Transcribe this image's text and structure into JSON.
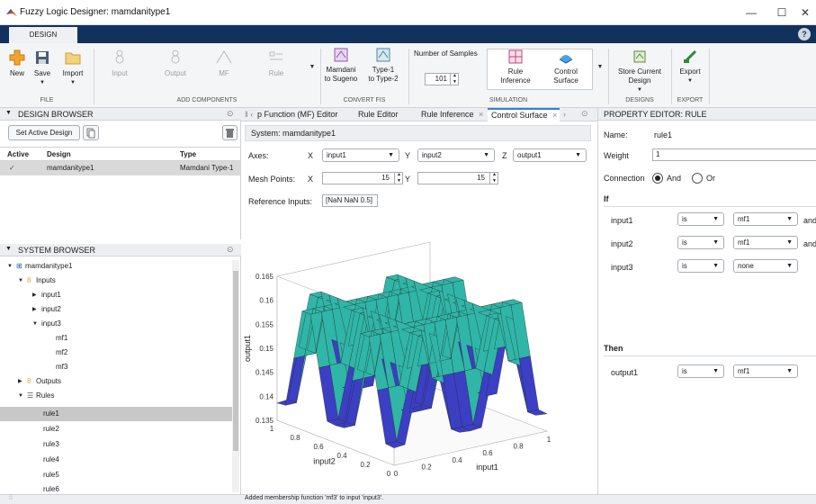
{
  "window": {
    "title": "Fuzzy Logic Designer: mamdanitype1",
    "minimize": "—",
    "maximize": "☐",
    "close": "✕"
  },
  "tabs": {
    "design": "DESIGN",
    "help": "?"
  },
  "ribbon": {
    "file": {
      "new": "New",
      "save": "Save",
      "import": "Import",
      "group": "FILE"
    },
    "add_components": {
      "input": "Input",
      "output": "Output",
      "mf": "MF",
      "rule": "Rule",
      "group": "ADD COMPONENTS"
    },
    "convert": {
      "mamdani_to_sugeno": [
        "Mamdani",
        "to Sugeno"
      ],
      "type1_to_type2": [
        "Type-1",
        "to Type-2"
      ],
      "group": "CONVERT FIS"
    },
    "simulation": {
      "num_samples_label": "Number of Samples",
      "num_samples_value": "101",
      "rule_inference": [
        "Rule",
        "Inference"
      ],
      "control_surface": [
        "Control",
        "Surface"
      ],
      "group": "SIMULATION"
    },
    "designs": {
      "store_current": [
        "Store Current",
        "Design"
      ],
      "group": "DESIGNS"
    },
    "export": {
      "export": "Export",
      "group": "EXPORT"
    }
  },
  "design_browser": {
    "title": "DESIGN BROWSER",
    "set_active": "Set Active Design",
    "columns": [
      "Active",
      "Design",
      "Type"
    ],
    "rows": [
      {
        "active": "✓",
        "design": "mamdanitype1",
        "type": "Mamdani Type-1"
      }
    ]
  },
  "system_browser": {
    "title": "SYSTEM BROWSER",
    "tree": [
      "mamdanitype1",
      "Inputs",
      "input1",
      "input2",
      "input3",
      "mf1",
      "mf2",
      "mf3",
      "Outputs",
      "Rules",
      "rule1",
      "rule2",
      "rule3",
      "rule4",
      "rule5",
      "rule6"
    ]
  },
  "doc_tabs": [
    "p Function (MF) Editor",
    "Rule Editor",
    "Rule Inference",
    "Control Surface"
  ],
  "surface": {
    "system_label": "System: mamdanitype1",
    "axes_label": "Axes:",
    "x_label": "X",
    "x_value": "input1",
    "y_label": "Y",
    "y_value": "input2",
    "z_label": "Z",
    "z_value": "output1",
    "mesh_label": "Mesh Points:",
    "mesh_x": "15",
    "mesh_y": "15",
    "ref_label": "Reference Inputs:",
    "ref_value": "[NaN NaN 0.5]"
  },
  "chart_data": {
    "type": "surface",
    "xlabel": "input1",
    "ylabel": "input2",
    "zlabel": "output1",
    "x": [
      0,
      0.2,
      0.4,
      0.6,
      0.8,
      1
    ],
    "y": [
      0,
      0.2,
      0.4,
      0.6,
      0.8,
      1
    ],
    "zlim": [
      0.135,
      0.165
    ],
    "z_ticks": [
      "0.165",
      "0.16",
      "0.155",
      "0.15",
      "0.145",
      "0.14",
      "0.135"
    ],
    "x_ticks": [
      "0",
      "0.2",
      "0.4",
      "0.6",
      "0.8",
      "1"
    ],
    "y_ticks": [
      "0",
      "0.2",
      "0.4",
      "0.6",
      "0.8",
      "1"
    ],
    "colors": {
      "low": "#3b3fc4",
      "mid": "#2fb6a8",
      "high": "#f2e714"
    }
  },
  "property_editor": {
    "title": "PROPERTY EDITOR: RULE",
    "name_label": "Name:",
    "name_value": "rule1",
    "weight_label": "Weight",
    "weight_value": "1",
    "connection_label": "Connection",
    "and_label": "And",
    "or_label": "Or",
    "if_label": "If",
    "if_rows": [
      {
        "var": "input1",
        "is": "is",
        "mf": "mf1",
        "tail": "and"
      },
      {
        "var": "input2",
        "is": "is",
        "mf": "mf1",
        "tail": "and"
      },
      {
        "var": "input3",
        "is": "is",
        "mf": "none",
        "tail": ""
      }
    ],
    "then_label": "Then",
    "then_rows": [
      {
        "var": "output1",
        "is": "is",
        "mf": "mf1"
      }
    ]
  },
  "status": {
    "message": "Added membership function 'mf3' to input 'input3'."
  }
}
